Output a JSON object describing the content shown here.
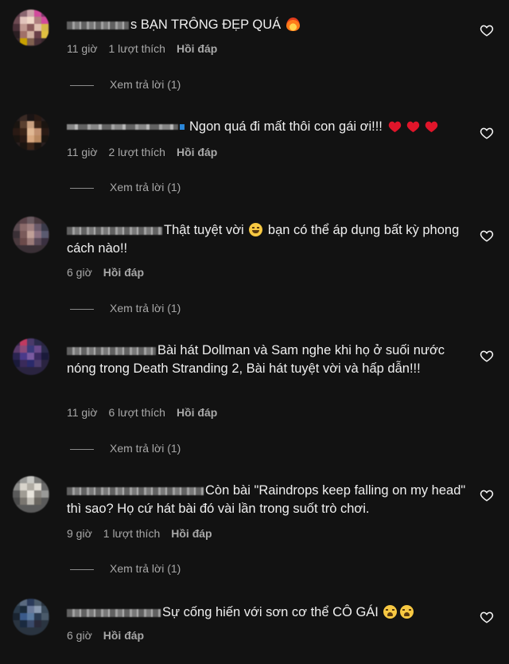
{
  "comments": [
    {
      "text": "s BẠN TRÔNG ĐẸP QUÁ",
      "time": "11 giờ",
      "likes": "1 lượt thích",
      "reply": "Hồi đáp",
      "view_replies": "Xem trả lời (1)"
    },
    {
      "text": "Ngon quá đi mất thôi con gái ơi!!!",
      "time": "11 giờ",
      "likes": "2 lượt thích",
      "reply": "Hồi đáp",
      "view_replies": "Xem trả lời (1)"
    },
    {
      "text": "Thật tuyệt vời",
      "text_after": "bạn có thể áp dụng bất kỳ phong cách nào!!",
      "time": "6 giờ",
      "reply": "Hồi đáp",
      "view_replies": "Xem trả lời (1)"
    },
    {
      "text": "Bài hát Dollman và Sam nghe khi họ ở suối nước nóng trong Death Stranding 2, Bài hát tuyệt vời và hấp dẫn!!!",
      "time": "11 giờ",
      "likes": "6 lượt thích",
      "reply": "Hồi đáp",
      "view_replies": "Xem trả lời (1)"
    },
    {
      "text": "Còn bài \"Raindrops keep falling on my head\" thì sao? Họ cứ hát bài đó vài lần trong suốt trò chơi.",
      "time": "9 giờ",
      "likes": "1 lượt thích",
      "reply": "Hồi đáp",
      "view_replies": "Xem trả lời (1)"
    },
    {
      "text": "Sự cống hiến với sơn cơ thể CÔ GÁI",
      "time": "6 giờ",
      "reply": "Hồi đáp"
    }
  ],
  "colors": {
    "background": "#121212",
    "text": "#f0f0f0",
    "meta": "#a8a8a8",
    "heart_emoji": "#e0152a"
  },
  "icons": {
    "like": "heart-outline-icon",
    "fire": "fire-emoji",
    "heart": "red-heart-emoji",
    "smile": "grinning-squint-emoji",
    "weary": "weary-face-emoji"
  }
}
